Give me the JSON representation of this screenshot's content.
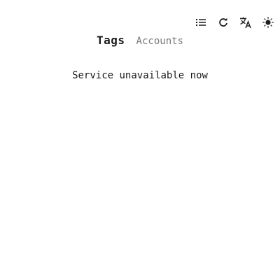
{
  "toolbar": {
    "icons": [
      "list-icon",
      "refresh-icon",
      "translate-icon",
      "theme-sun-icon"
    ]
  },
  "tabs": [
    {
      "label": "Tags",
      "active": true
    },
    {
      "label": "Accounts",
      "active": false
    }
  ],
  "main": {
    "message": "Service unavailable now"
  },
  "colors": {
    "text": "#1a1a1a",
    "muted": "#7a7a7a",
    "background": "#ffffff"
  }
}
